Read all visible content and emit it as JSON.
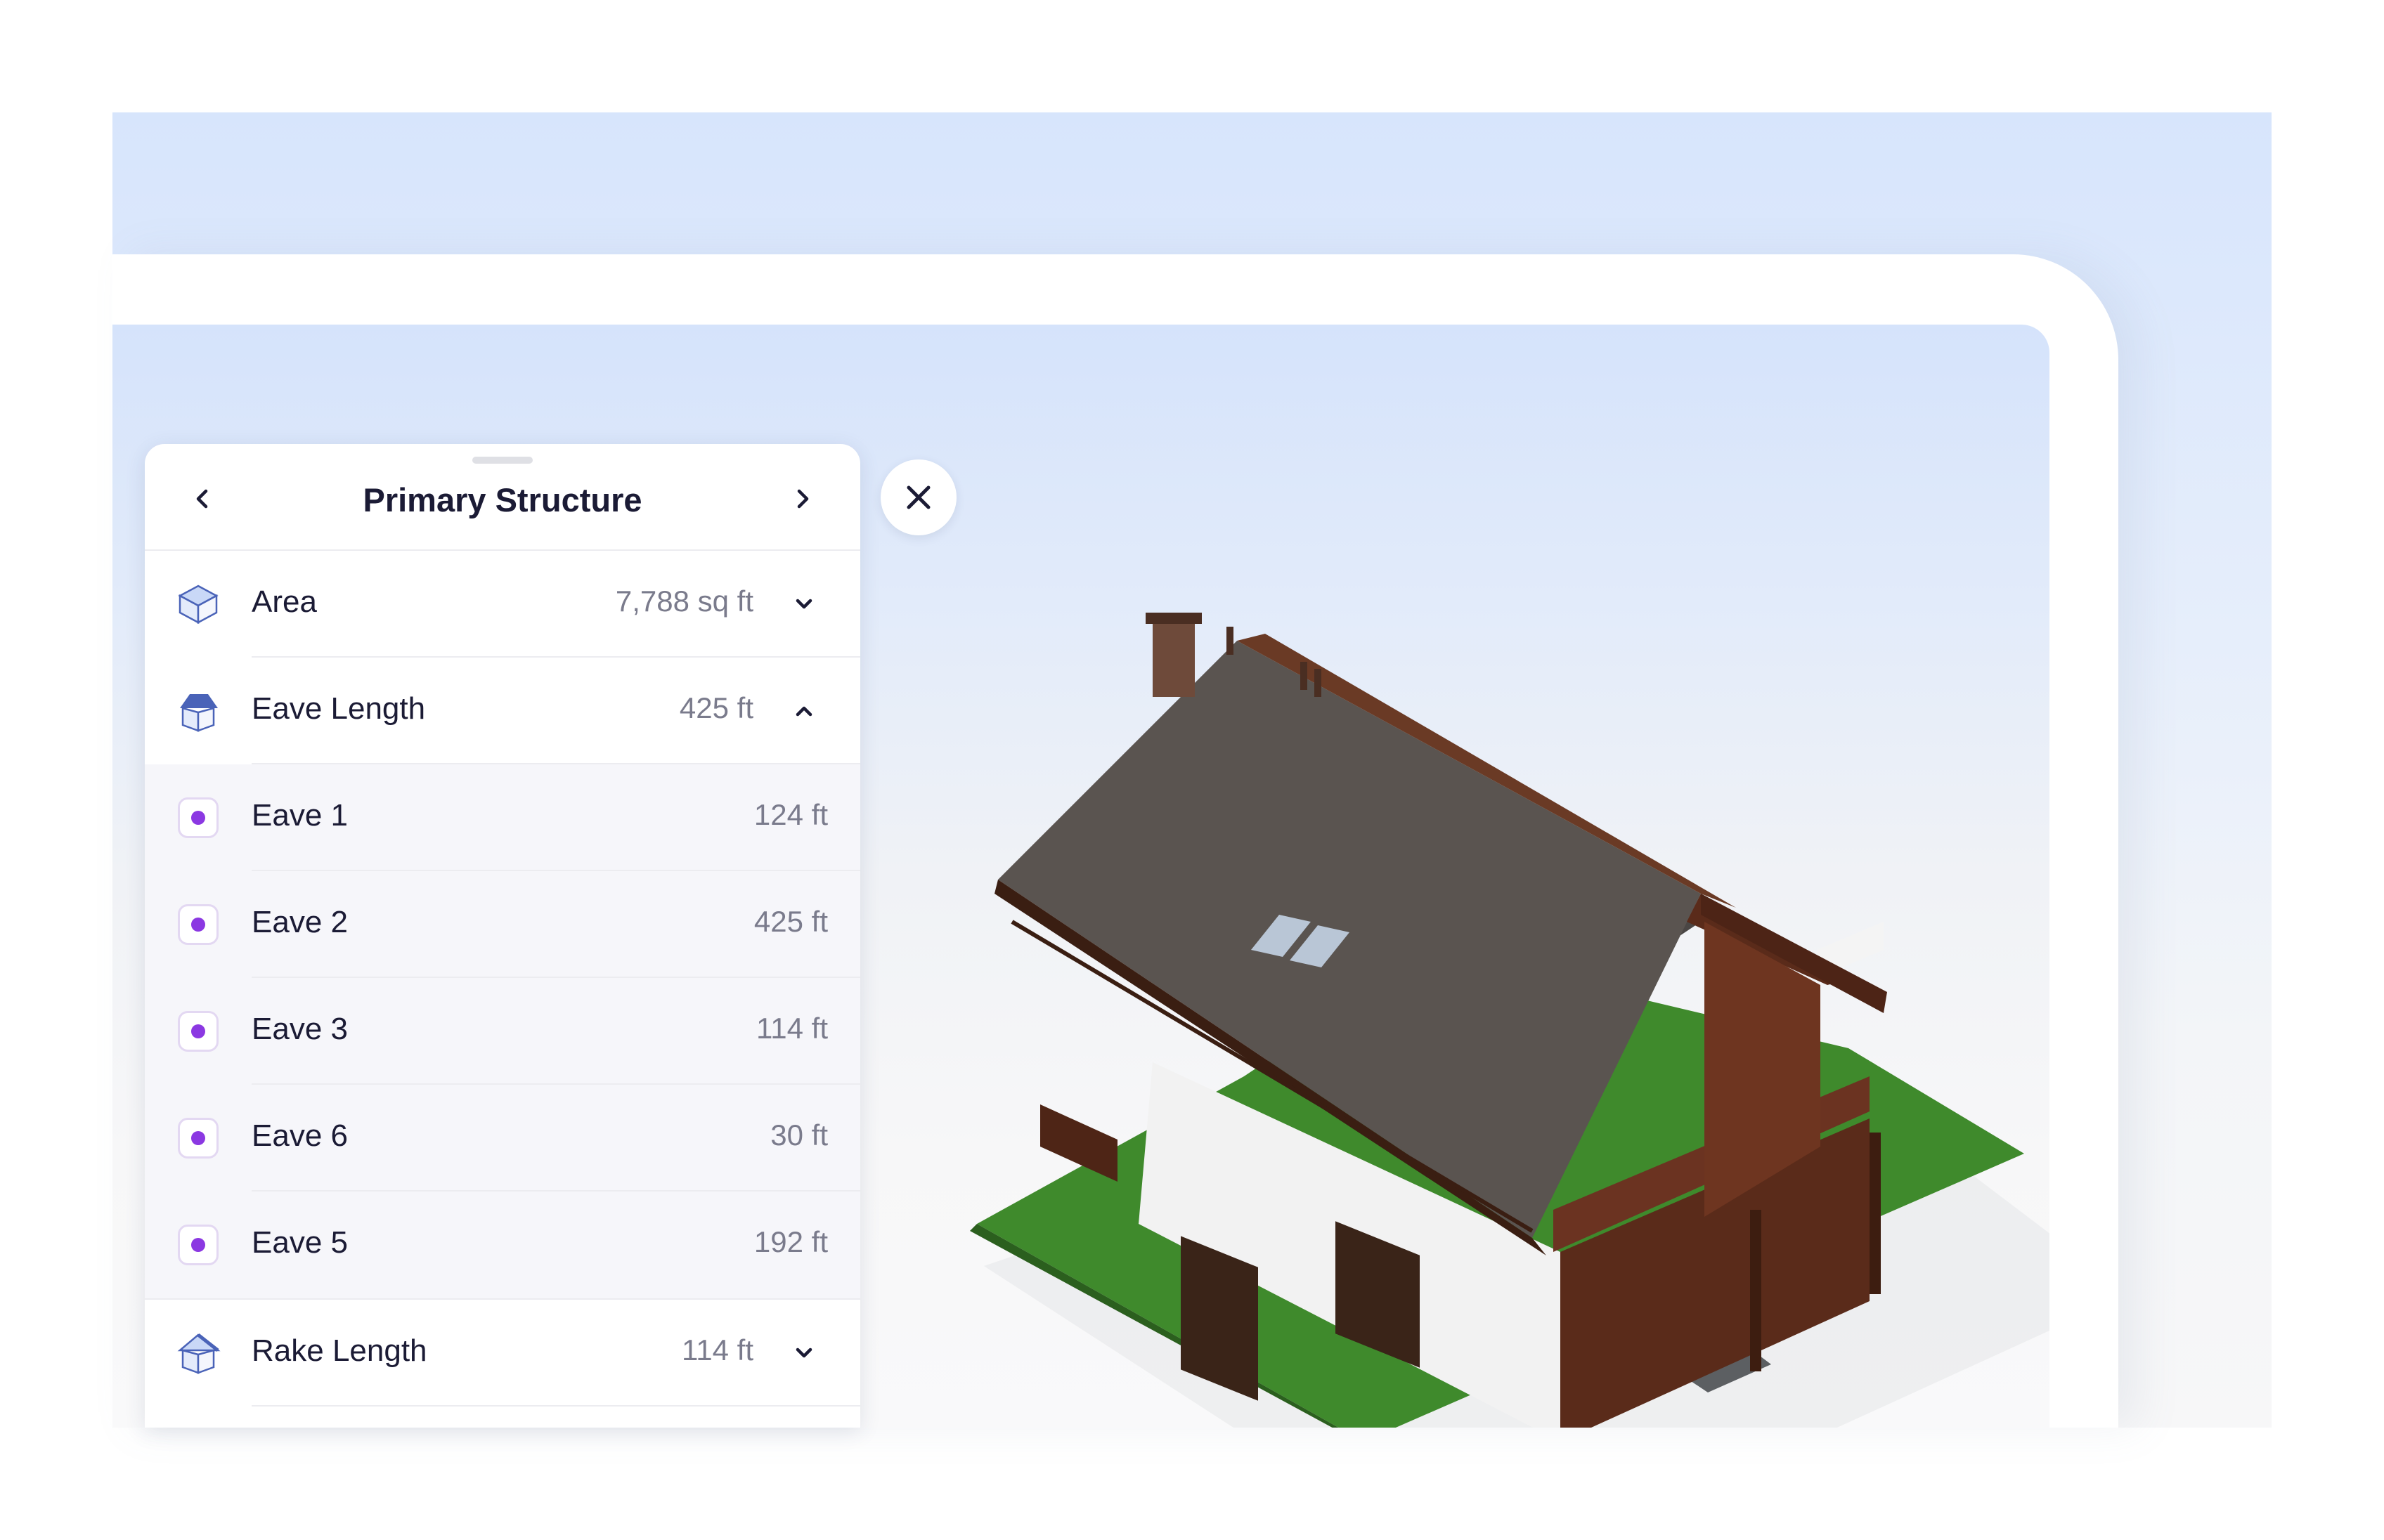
{
  "panel": {
    "title": "Primary Structure",
    "rows": [
      {
        "label": "Area",
        "value": "7,788 sq ft",
        "icon": "area-icon",
        "expanded": false
      },
      {
        "label": "Eave Length",
        "value": "425 ft",
        "icon": "eave-length-icon",
        "expanded": true
      },
      {
        "label": "Rake Length",
        "value": "114 ft",
        "icon": "rake-length-icon",
        "expanded": false
      }
    ],
    "eaves": [
      {
        "label": "Eave 1",
        "value": "124 ft"
      },
      {
        "label": "Eave 2",
        "value": "425 ft"
      },
      {
        "label": "Eave 3",
        "value": "114 ft"
      },
      {
        "label": "Eave 6",
        "value": "30 ft"
      },
      {
        "label": "Eave 5",
        "value": "192 ft"
      }
    ]
  },
  "colors": {
    "accent": "#8b38e2",
    "text": "#1b1b35",
    "muted": "#7a7b8c",
    "sky": "#d5e3fb"
  }
}
